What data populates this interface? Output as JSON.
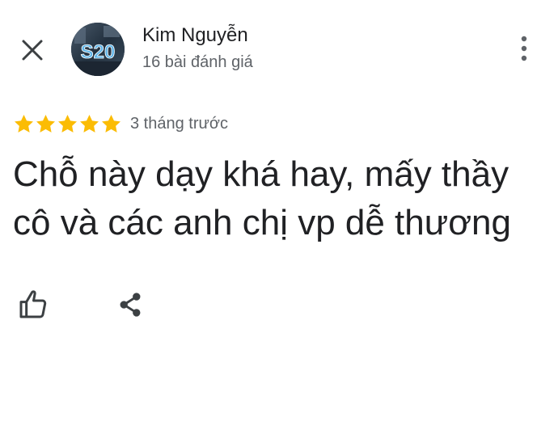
{
  "header": {
    "close_icon": "close-icon",
    "avatar_text": "S20",
    "reviewer_name": "Kim Nguyễn",
    "review_count": "16 bài đánh giá",
    "more_icon": "more-vert-icon"
  },
  "review": {
    "rating": 5,
    "max_rating": 5,
    "star_color": "#fbbc04",
    "time_ago": "3 tháng trước",
    "text": "Chỗ này dạy khá hay, mấy thầy cô và các anh chị vp dễ thương"
  },
  "actions": {
    "like_icon": "thumb-up-icon",
    "share_icon": "share-icon"
  }
}
